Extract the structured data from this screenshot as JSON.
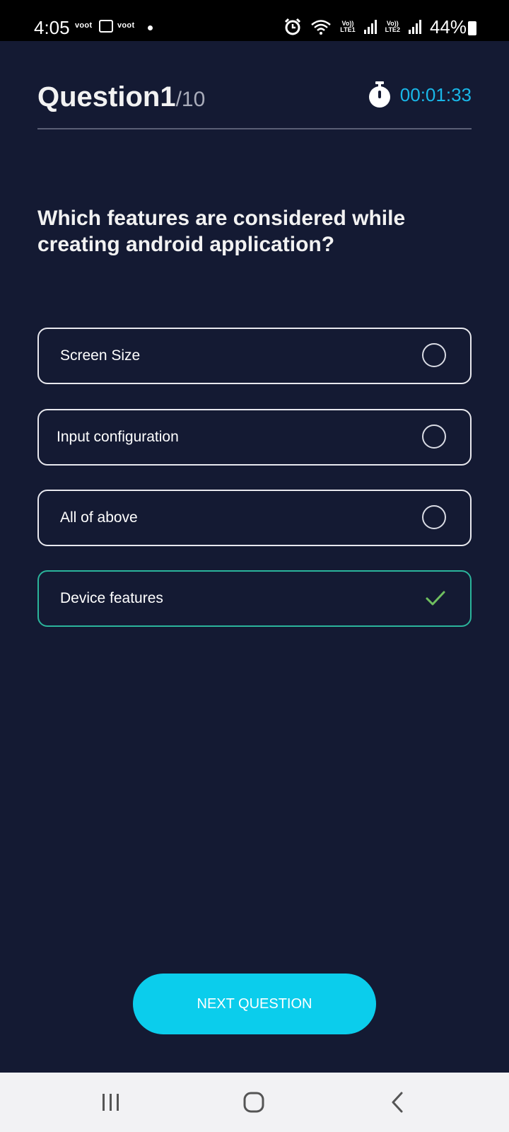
{
  "status_bar": {
    "time": "4:05",
    "app1": "voot",
    "app2": "voot",
    "net1_top": "Vo))",
    "net1_bottom": "LTE1",
    "net2_top": "Vo))",
    "net2_bottom": "LTE2",
    "battery": "44%"
  },
  "quiz": {
    "question_label": "Question1",
    "question_total": "/10",
    "timer": "00:01:33",
    "question_text": "Which features are considered while creating android application?",
    "options": [
      {
        "label": "Screen Size",
        "state": "unselected"
      },
      {
        "label": "Input configuration",
        "state": "unselected"
      },
      {
        "label": "All of above",
        "state": "unselected"
      },
      {
        "label": "Device features",
        "state": "correct"
      }
    ],
    "next_label": "NEXT QUESTION"
  },
  "colors": {
    "background": "#141a33",
    "accent": "#0bcdec",
    "timer": "#19b7e8",
    "correct_border": "#2bb49b",
    "check": "#6fbf5f"
  },
  "icons": {
    "timer": "stopwatch-icon",
    "correct": "checkmark-icon",
    "option": "radio-circle-icon",
    "nav": [
      "recent-apps-icon",
      "home-icon",
      "back-icon"
    ]
  }
}
